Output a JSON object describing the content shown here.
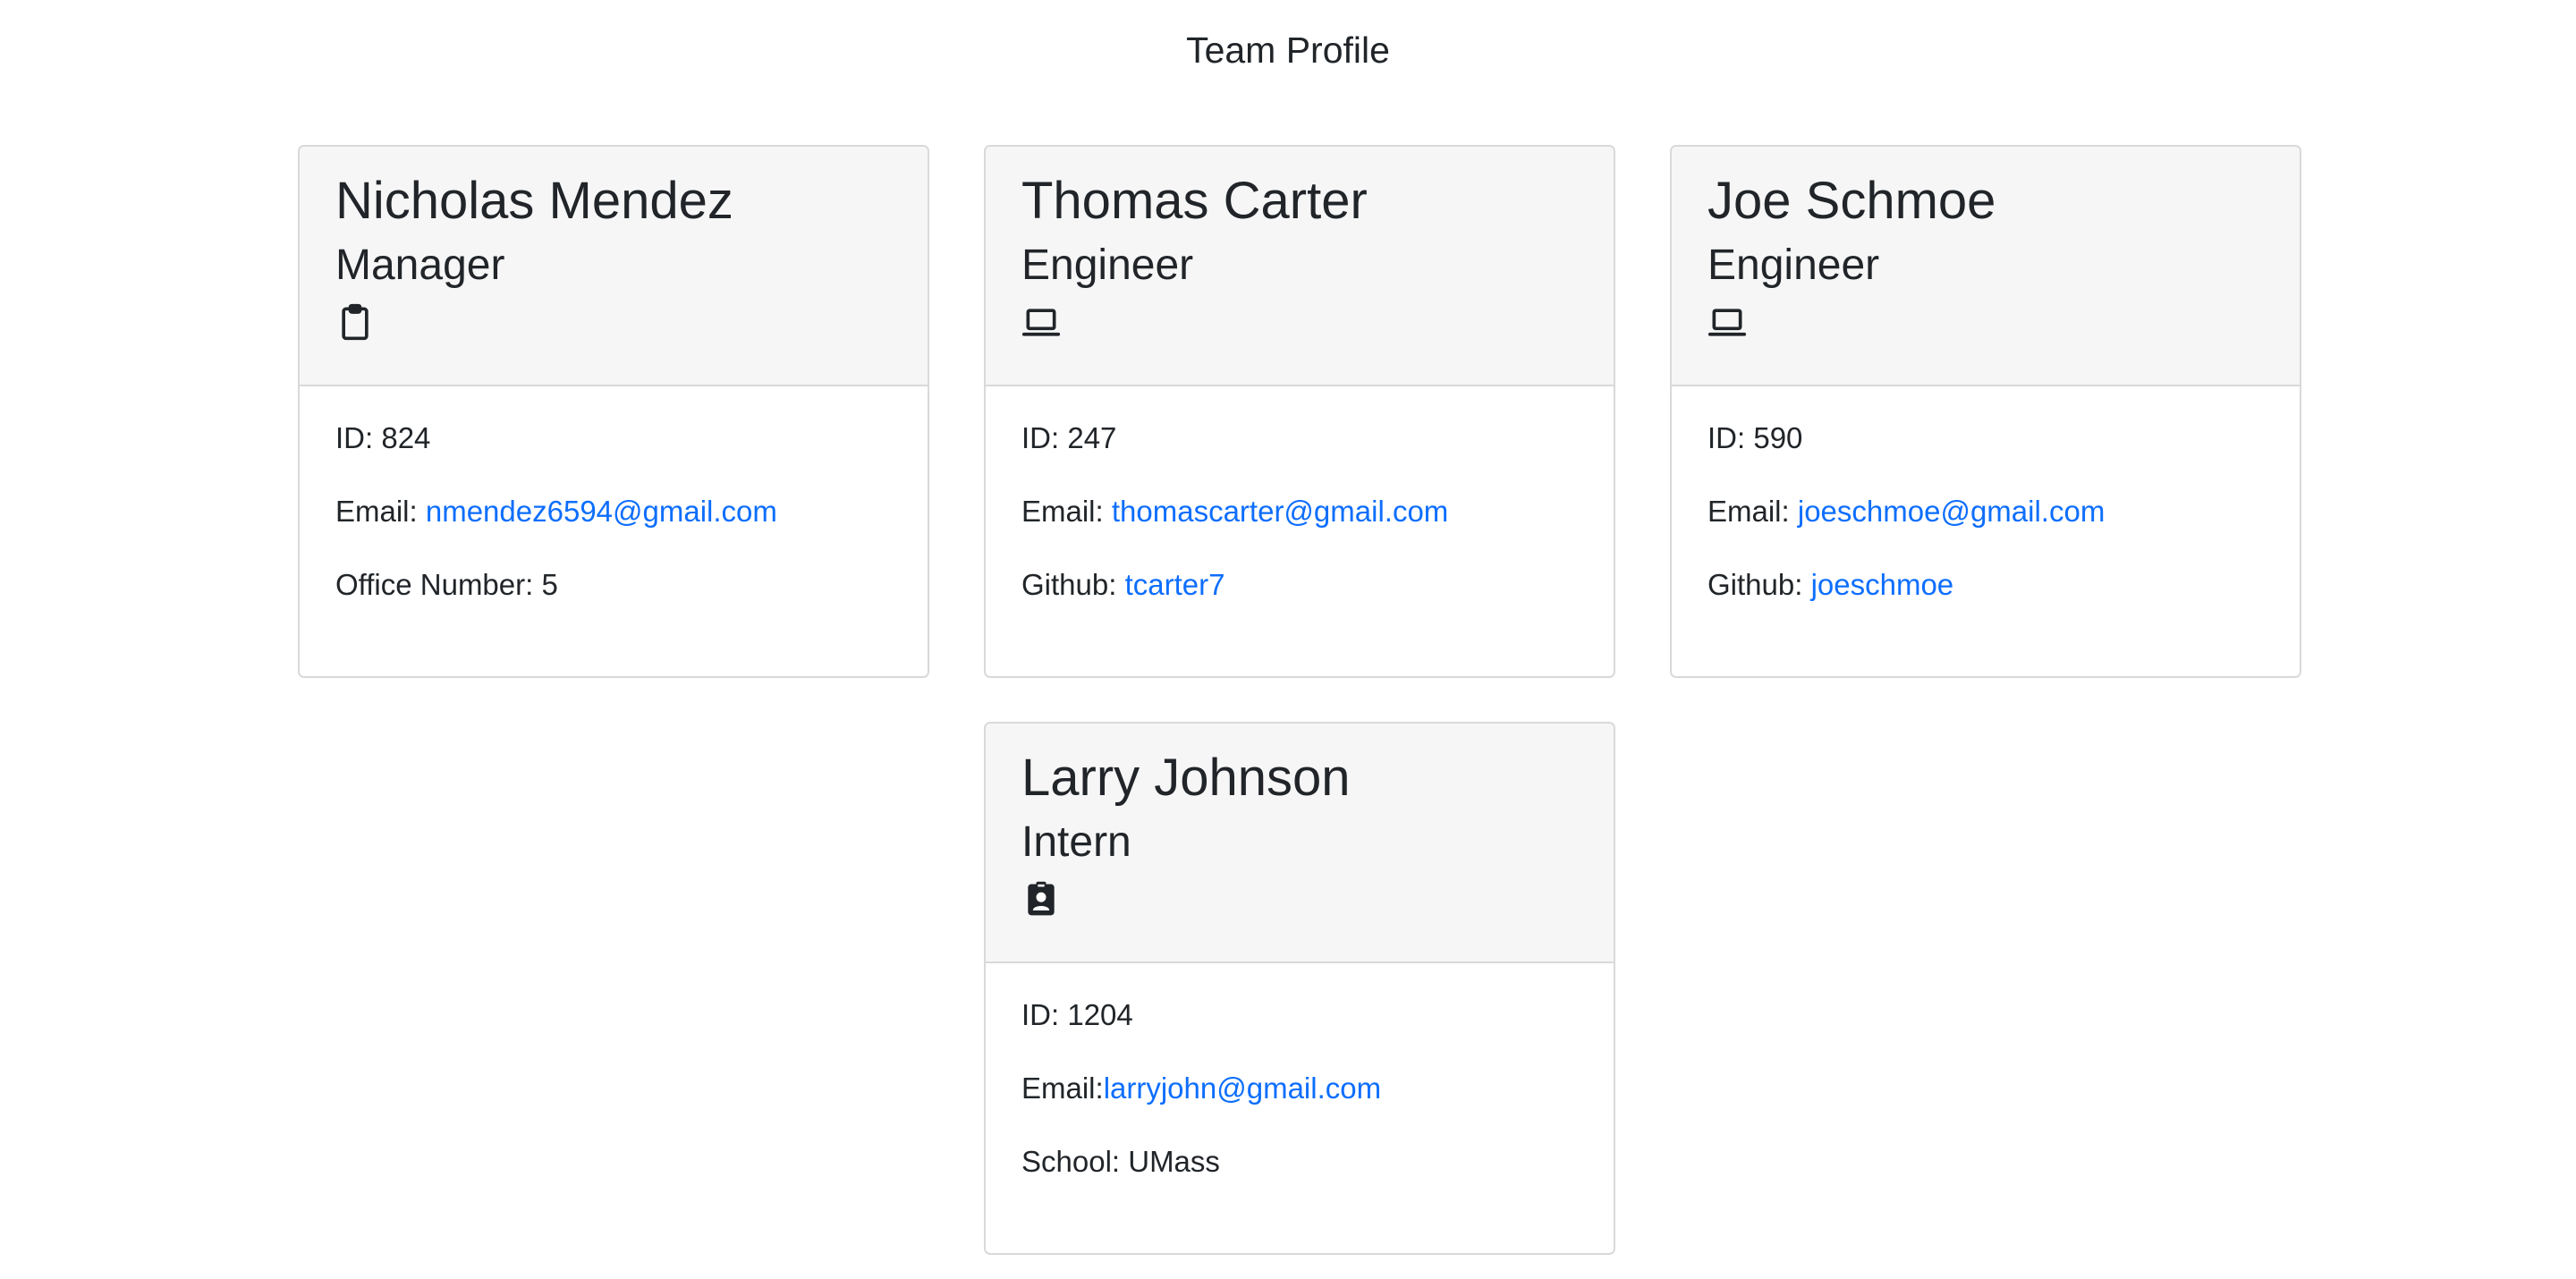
{
  "page": {
    "title": "Team Profile"
  },
  "colors": {
    "link": "#0d6efd",
    "header_bg": "#f6f6f6",
    "border": "#d9d9d9",
    "text": "#212529"
  },
  "team": [
    {
      "name": "Nicholas Mendez",
      "role": "Manager",
      "icon": "clipboard-icon",
      "id_label": "ID: 824",
      "email_label": "Email: ",
      "email": "nmendez6594@gmail.com",
      "extra_label": "Office Number: 5",
      "extra_link": ""
    },
    {
      "name": "Thomas Carter",
      "role": "Engineer",
      "icon": "laptop-icon",
      "id_label": "ID: 247",
      "email_label": "Email: ",
      "email": "thomascarter@gmail.com",
      "extra_label": "Github: ",
      "extra_link": "tcarter7"
    },
    {
      "name": "Joe Schmoe",
      "role": "Engineer",
      "icon": "laptop-icon",
      "id_label": "ID: 590",
      "email_label": "Email: ",
      "email": "joeschmoe@gmail.com",
      "extra_label": "Github: ",
      "extra_link": "joeschmoe"
    },
    {
      "name": "Larry Johnson",
      "role": "Intern",
      "icon": "id-badge-icon",
      "id_label": "ID: 1204",
      "email_label": "Email:",
      "email": "larryjohn@gmail.com",
      "extra_label": "School: UMass",
      "extra_link": ""
    }
  ]
}
